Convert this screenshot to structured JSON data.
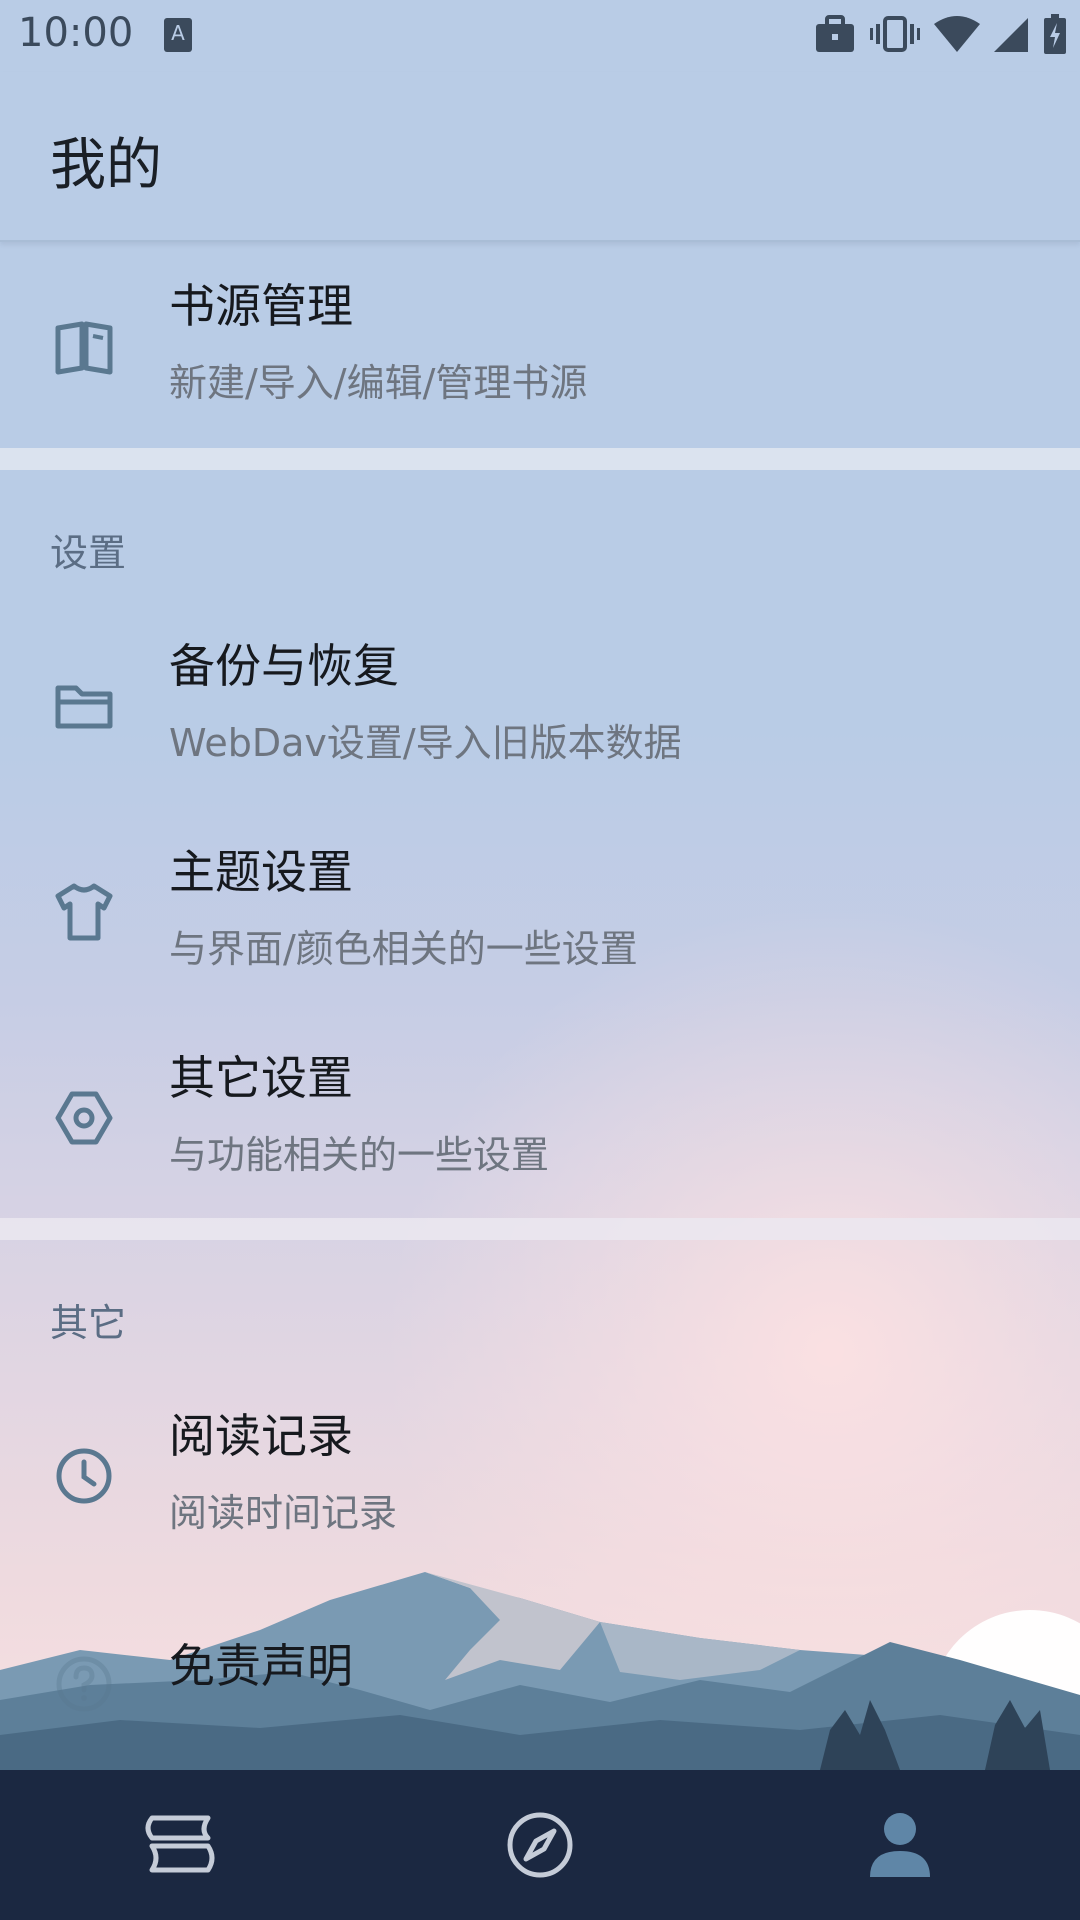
{
  "status_bar": {
    "time": "10:00",
    "icons": [
      "a-notification-icon",
      "briefcase-icon",
      "vibrate-icon",
      "wifi-icon",
      "signal-icon",
      "battery-charging-icon"
    ]
  },
  "header": {
    "title": "我的"
  },
  "book_source": {
    "title": "书源管理",
    "subtitle": "新建/导入/编辑/管理书源",
    "icon": "book-icon"
  },
  "settings": {
    "section_label": "设置",
    "items": [
      {
        "title": "备份与恢复",
        "subtitle": "WebDav设置/导入旧版本数据",
        "icon": "folder-icon"
      },
      {
        "title": "主题设置",
        "subtitle": "与界面/颜色相关的一些设置",
        "icon": "tshirt-icon"
      },
      {
        "title": "其它设置",
        "subtitle": "与功能相关的一些设置",
        "icon": "hexagon-settings-icon"
      }
    ]
  },
  "other": {
    "section_label": "其它",
    "items": [
      {
        "title": "阅读记录",
        "subtitle": "阅读时间记录",
        "icon": "clock-icon"
      },
      {
        "title": "免责声明",
        "icon": "help-circle-icon"
      }
    ]
  },
  "bottom_nav": {
    "items": [
      {
        "icon": "bookshelf-icon"
      },
      {
        "icon": "compass-icon"
      },
      {
        "icon": "person-icon",
        "active": true
      }
    ]
  },
  "colors": {
    "icon_tint": "#5a7890",
    "nav_background": "#1b2841",
    "nav_icon": "#c5ccd8",
    "nav_icon_active": "#5f86a7"
  }
}
